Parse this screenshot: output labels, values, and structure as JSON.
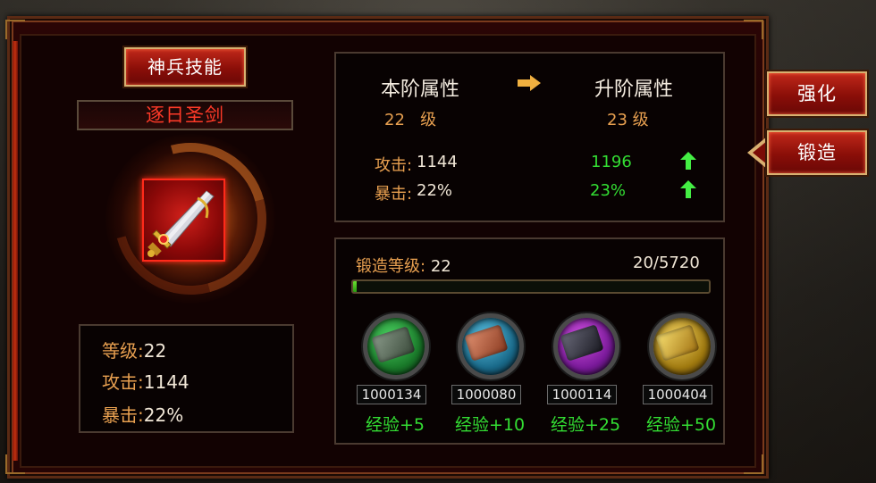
{
  "buttons": {
    "skill": "神兵技能",
    "enhance": "强化",
    "forge": "锻造"
  },
  "weapon": {
    "name": "逐日圣剑",
    "icon": "golden-sword-icon"
  },
  "stats": {
    "level_label": "等级:",
    "level_value": "22",
    "attack_label": "攻击:",
    "attack_value": "1144",
    "crit_label": "暴击:",
    "crit_value": "22%"
  },
  "attributes": {
    "current_header": "本阶属性",
    "next_header": "升阶属性",
    "current_level": "22",
    "next_level": "23",
    "level_unit": "级",
    "attack_label": "攻击:",
    "attack_current": "1144",
    "attack_next": "1196",
    "crit_label": "暴击:",
    "crit_current": "22%",
    "crit_next": "23%"
  },
  "forge": {
    "level_label": "锻造等级:",
    "level_value": "22",
    "progress_text": "20/5720",
    "progress_fraction": 0.0035,
    "materials": [
      {
        "icon": "green-ore-icon",
        "count": "1000134",
        "exp": "经验+5",
        "color": "#2aa040"
      },
      {
        "icon": "blue-ingot-icon",
        "count": "1000080",
        "exp": "经验+10",
        "color": "#2a8ab0"
      },
      {
        "icon": "purple-ingot-icon",
        "count": "1000114",
        "exp": "经验+25",
        "color": "#a020c0"
      },
      {
        "icon": "gold-ingot-icon",
        "count": "1000404",
        "exp": "经验+50",
        "color": "#d0a020"
      }
    ]
  },
  "colors": {
    "accent_orange": "#e8a050",
    "positive_green": "#33dd33",
    "weapon_name_red": "#ff3a28"
  }
}
